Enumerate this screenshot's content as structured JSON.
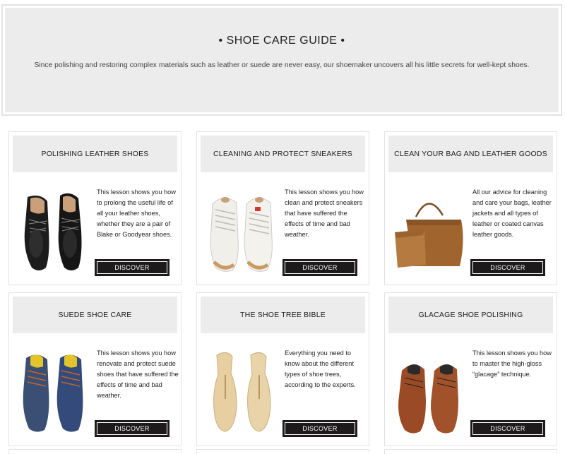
{
  "header": {
    "title": "SHOE CARE GUIDE",
    "subtitle": "Since polishing and restoring complex materials such as leather or suede are never easy, our shoemaker uncovers all his little secrets for well-kept shoes."
  },
  "cards": [
    {
      "title": "POLISHING LEATHER SHOES",
      "text": "This lesson shows you how to prolong the useful life of all your leather shoes, whether they are a pair of Blake or Goodyear shoes.",
      "button": "DISCOVER",
      "image": "black-oxford-shoes"
    },
    {
      "title": "CLEANING AND PROTECT SNEAKERS",
      "text": "This lesson shows you how clean and protect sneakers that have suffered the effects of time and bad weather.",
      "button": "DISCOVER",
      "image": "white-sneakers"
    },
    {
      "title": "CLEAN YOUR BAG AND LEATHER GOODS",
      "text": "All our advice for cleaning and care your bags, leather jackets and all types of leather or coated canvas leather goods.",
      "button": "DISCOVER",
      "image": "brown-leather-bag"
    },
    {
      "title": "SUEDE SHOE CARE",
      "text": "This lesson shows you how renovate and protect suede shoes that have suffered the effects of time and bad weather.",
      "button": "DISCOVER",
      "image": "blue-suede-shoes"
    },
    {
      "title": "THE SHOE TREE BIBLE",
      "text": "Everything you need to know about the different types of shoe trees, according to the experts.",
      "button": "DISCOVER",
      "image": "wooden-shoe-trees"
    },
    {
      "title": "GLACAGE SHOE POLISHING",
      "text": "This lesson shows you how to master the high-gloss “glacage” technique.",
      "button": "DISCOVER",
      "image": "brown-glacage-shoes"
    }
  ]
}
